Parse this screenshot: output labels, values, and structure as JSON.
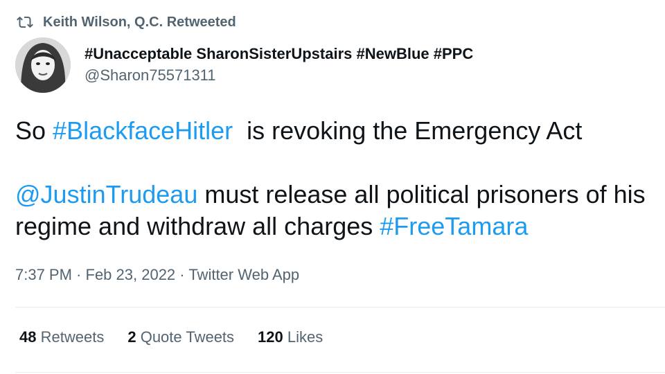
{
  "retweet_context": {
    "icon": "retweet-icon",
    "text": "Keith Wilson, Q.C. Retweeted"
  },
  "author": {
    "display_name": "#Unacceptable SharonSisterUpstairs #NewBlue #PPC",
    "handle": "@Sharon75571311"
  },
  "tweet": {
    "para1": [
      {
        "text": "So ",
        "link": false
      },
      {
        "text": "#BlackfaceHitler",
        "link": true
      },
      {
        "text": "  is revoking the Emergency Act",
        "link": false
      }
    ],
    "para2": [
      {
        "text": "@JustinTrudeau",
        "link": true
      },
      {
        "text": " must release all political prisoners of his regime and withdraw all charges ",
        "link": false
      },
      {
        "text": "#FreeTamara",
        "link": true
      }
    ]
  },
  "meta": {
    "time": "7:37 PM",
    "date": "Feb 23, 2022",
    "source": "Twitter Web App",
    "separator": " · "
  },
  "stats": {
    "retweets_count": "48",
    "retweets_label": "Retweets",
    "quotes_count": "2",
    "quotes_label": "Quote Tweets",
    "likes_count": "120",
    "likes_label": "Likes"
  },
  "colors": {
    "link": "#1d9bf0",
    "secondary_text": "#536471",
    "primary_text": "#0f1419",
    "divider": "#e6ecf0"
  }
}
